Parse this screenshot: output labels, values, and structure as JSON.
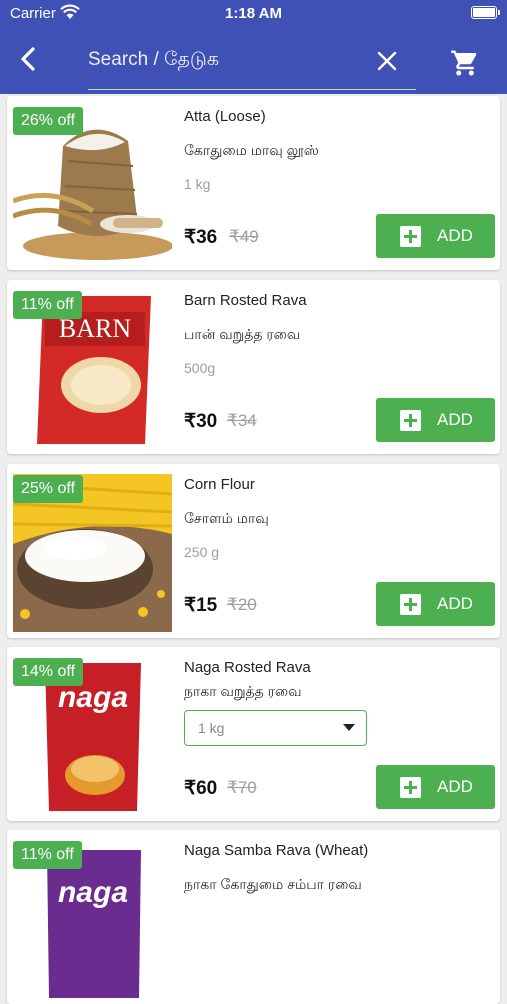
{
  "status_bar": {
    "carrier": "Carrier",
    "time": "1:18 AM"
  },
  "header": {
    "search_placeholder": "Search / தேடுக",
    "back_icon": "back-chevron-icon",
    "clear_icon": "close-icon",
    "cart_icon": "cart-icon",
    "bar_color": "#3f51b5"
  },
  "colors": {
    "accent": "#4caf50",
    "muted": "#9e9e9e"
  },
  "products": [
    {
      "discount": "26% off",
      "name": "Atta (Loose)",
      "tamil": "கோதுமை மாவு லூஸ்",
      "weight": "1 kg",
      "price": "₹36",
      "mrp": "₹49",
      "add_label": "ADD"
    },
    {
      "discount": "11% off",
      "name": "Barn Rosted Rava",
      "tamil": "பான் வறுத்த ரவை",
      "weight": "500g",
      "price": "₹30",
      "mrp": "₹34",
      "add_label": "ADD",
      "brand_text": "BARN"
    },
    {
      "discount": "25% off",
      "name": "Corn Flour",
      "tamil": "சோளம் மாவு",
      "weight": "250 g",
      "price": "₹15",
      "mrp": "₹20",
      "add_label": "ADD"
    },
    {
      "discount": "14% off",
      "name": "Naga Rosted Rava",
      "tamil": "நாகா வறுத்த ரவை",
      "weight_select": "1 kg",
      "price": "₹60",
      "mrp": "₹70",
      "add_label": "ADD",
      "brand_text": "naga"
    },
    {
      "discount": "11% off",
      "name": "Naga Samba Rava (Wheat)",
      "tamil": "நாகா கோதுமை சம்பா ரவை",
      "brand_text": "naga"
    }
  ]
}
